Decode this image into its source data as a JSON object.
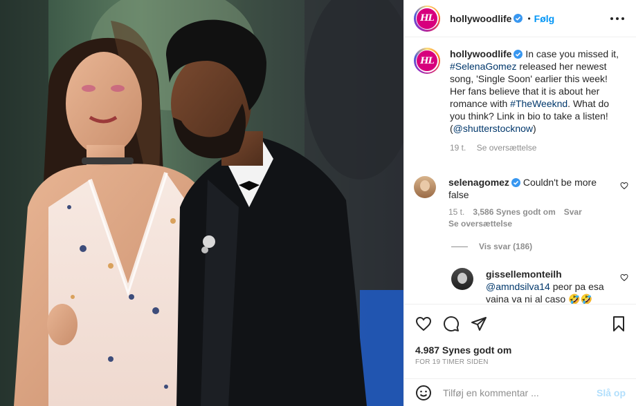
{
  "post": {
    "author": "hollywoodlife",
    "avatar_text": "HL",
    "verified": true,
    "separator": "•",
    "follow_label": "Følg",
    "caption_parts": {
      "p1": "In case you missed it, ",
      "tag1": "#SelenaGomez",
      "p2": " released her newest song, 'Single Soon' earlier this week! Her fans believe that it is about her romance with ",
      "tag2": "#TheWeeknd",
      "p3": ". What do you think? Link in bio to take a listen! (",
      "mention": "@shutterstocknow",
      "p4": ")"
    },
    "caption_time": "19 t.",
    "caption_translate": "Se oversættelse"
  },
  "comments": [
    {
      "user": "selenagomez",
      "verified": true,
      "text": "Couldn't be more false",
      "time": "15 t.",
      "likes": "3,586 Synes godt om",
      "reply": "Svar",
      "translate": "Se oversættelse"
    }
  ],
  "view_replies": "Vis svar (186)",
  "reply": {
    "user": "gissellemonteilh",
    "mention": "@amndsilva14",
    "text": " peor pa esa vaina va ni al caso 🤣🤣"
  },
  "actions": {
    "icons": [
      "heart-icon",
      "comment-icon",
      "share-icon",
      "bookmark-icon"
    ],
    "likes": "4.987 Synes godt om",
    "timestamp": "FOR 19 TIMER SIDEN"
  },
  "add_comment": {
    "placeholder": "Tilføj en kommentar ...",
    "post_label": "Slå op",
    "icon": "emoji-icon"
  },
  "colors": {
    "link": "#00376b",
    "follow": "#0095f6",
    "muted": "#8e8e8e",
    "post_disabled": "#b2dffc",
    "brand_avatar": "#d7007d"
  }
}
